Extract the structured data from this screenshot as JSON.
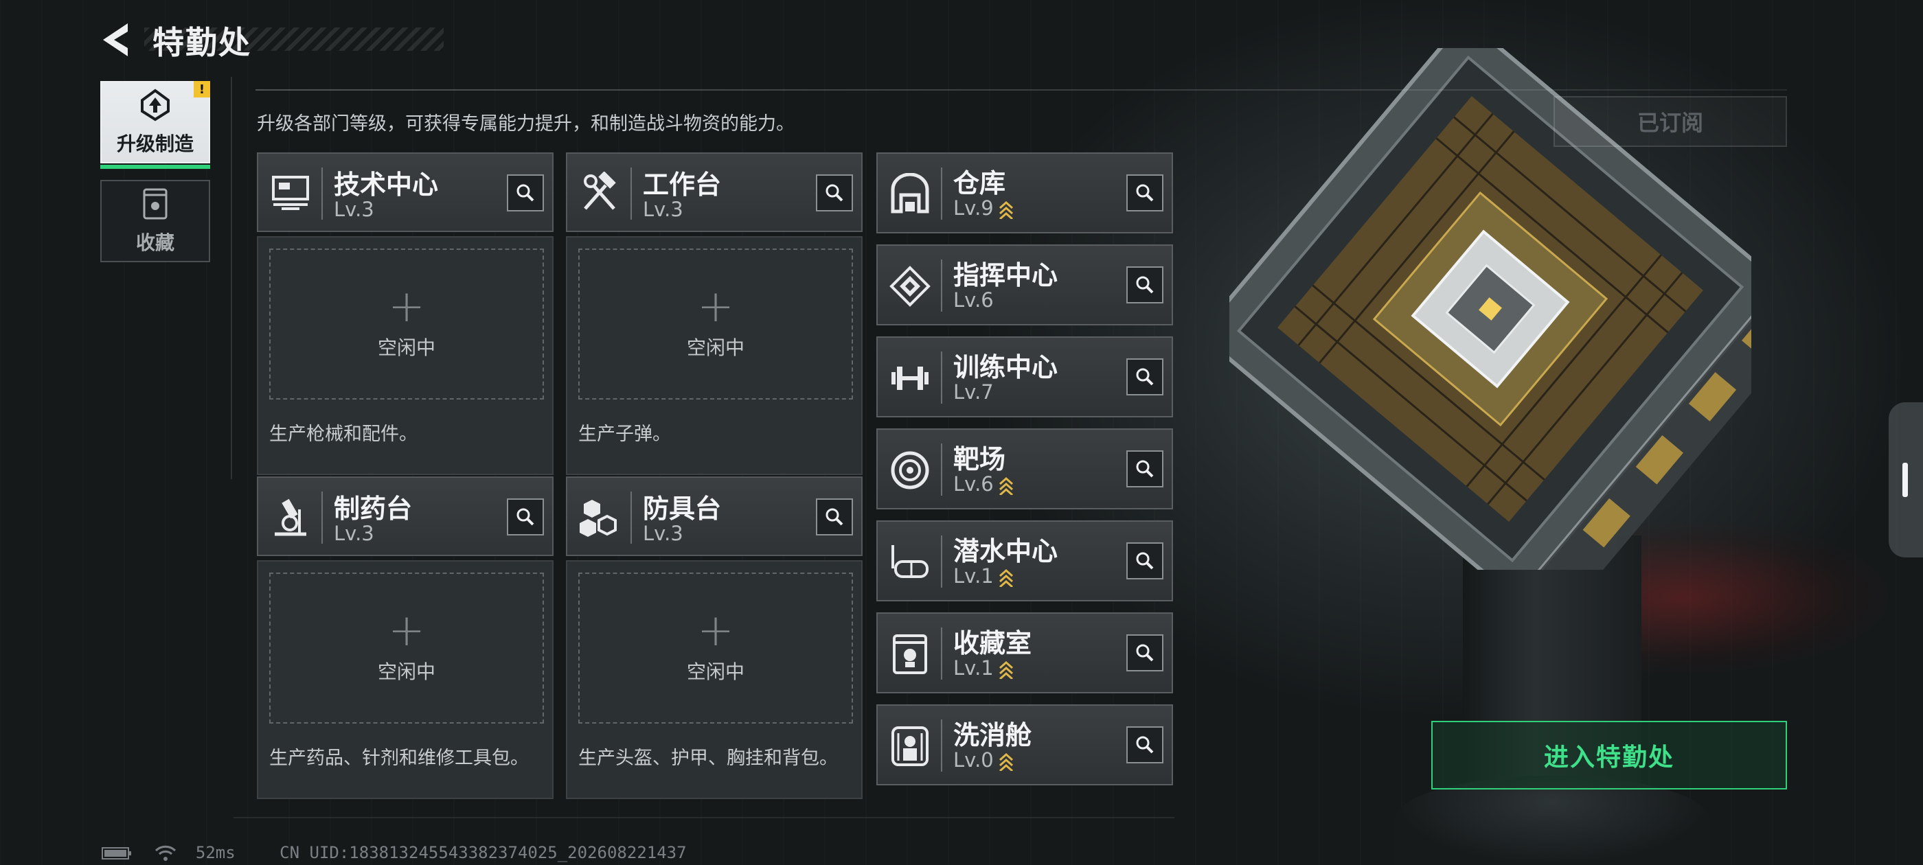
{
  "header": {
    "title": "特勤处"
  },
  "nav": [
    {
      "label": "升级制造",
      "active": true,
      "badge": "!"
    },
    {
      "label": "收藏",
      "active": false
    }
  ],
  "description": "升级各部门等级，可获得专属能力提升，和制造战斗物资的能力。",
  "subscribe_label": "已订阅",
  "workbenches": [
    {
      "name": "技术中心",
      "level": "Lv.3",
      "idle": "空闲中",
      "desc": "生产枪械和配件。"
    },
    {
      "name": "工作台",
      "level": "Lv.3",
      "idle": "空闲中",
      "desc": "生产子弹。"
    },
    {
      "name": "制药台",
      "level": "Lv.3",
      "idle": "空闲中",
      "desc": "生产药品、针剂和维修工具包。"
    },
    {
      "name": "防具台",
      "level": "Lv.3",
      "idle": "空闲中",
      "desc": "生产头盔、护甲、胸挂和背包。"
    }
  ],
  "facilities": [
    {
      "name": "仓库",
      "level": "Lv.9",
      "upgradable": true
    },
    {
      "name": "指挥中心",
      "level": "Lv.6",
      "upgradable": false
    },
    {
      "name": "训练中心",
      "level": "Lv.7",
      "upgradable": false
    },
    {
      "name": "靶场",
      "level": "Lv.6",
      "upgradable": true
    },
    {
      "name": "潜水中心",
      "level": "Lv.1",
      "upgradable": true
    },
    {
      "name": "收藏室",
      "level": "Lv.1",
      "upgradable": true
    },
    {
      "name": "洗消舱",
      "level": "Lv.0",
      "upgradable": true
    }
  ],
  "enter_button": "进入特勤处",
  "status": {
    "ping": "52ms",
    "uid": "CN UID:183813245543382374025_202608221437"
  },
  "colors": {
    "accent_green": "#2fd27a",
    "upgrade_gold": "#e0b84a",
    "badge_yellow": "#f2c12e"
  }
}
